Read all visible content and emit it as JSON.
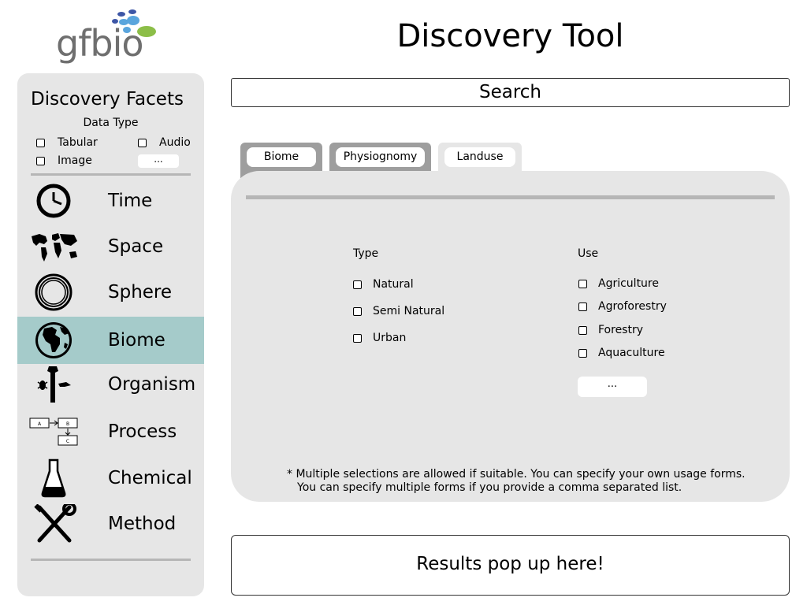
{
  "logo": {
    "text": "gfbio"
  },
  "app": {
    "title": "Discovery Tool"
  },
  "sidebar": {
    "title": "Discovery Facets",
    "data_type": {
      "title": "Data Type",
      "options": [
        "Tabular",
        "Audio",
        "Image"
      ],
      "more_label": "..."
    },
    "facets": [
      {
        "label": "Time",
        "icon": "clock-icon"
      },
      {
        "label": "Space",
        "icon": "world-map-icon"
      },
      {
        "label": "Sphere",
        "icon": "rings-icon"
      },
      {
        "label": "Biome",
        "icon": "globe-icon",
        "active": true
      },
      {
        "label": "Organism",
        "icon": "organism-icon"
      },
      {
        "label": "Process",
        "icon": "flow-diagram-icon"
      },
      {
        "label": "Chemical",
        "icon": "flask-icon"
      },
      {
        "label": "Method",
        "icon": "tools-icon"
      }
    ],
    "active_color": "#a5cbca"
  },
  "search": {
    "label": "Search"
  },
  "tabs": [
    {
      "label": "Biome"
    },
    {
      "label": "Physiognomy"
    },
    {
      "label": "Landuse",
      "active": true
    }
  ],
  "landuse": {
    "type": {
      "title": "Type",
      "options": [
        "Natural",
        "Semi Natural",
        "Urban"
      ]
    },
    "use": {
      "title": "Use",
      "options": [
        "Agriculture",
        "Agroforestry",
        "Forestry",
        "Aquaculture"
      ],
      "more_label": "..."
    },
    "note_line1": "* Multiple selections are allowed if suitable. You can specify your own usage forms.",
    "note_line2": "You can specify multiple forms if you provide a comma separated list."
  },
  "results": {
    "label": "Results pop up here!"
  }
}
